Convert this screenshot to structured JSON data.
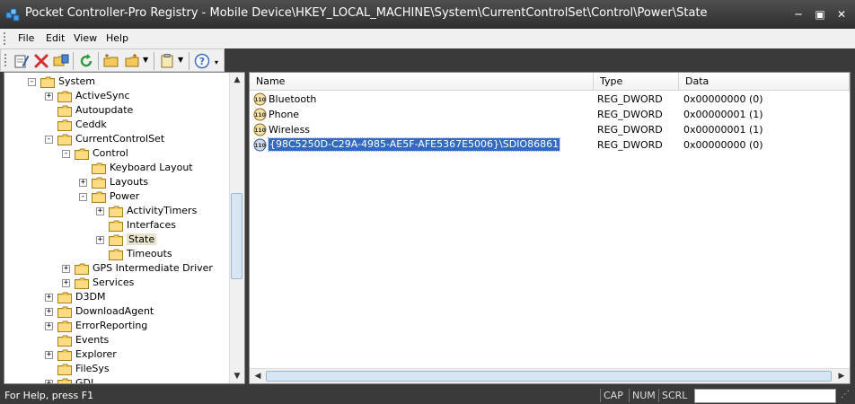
{
  "window": {
    "title": "Pocket Controller-Pro Registry - Mobile Device\\HKEY_LOCAL_MACHINE\\System\\CurrentControlSet\\Control\\Power\\State",
    "minimize_glyph": "─",
    "restore_glyph": "▣",
    "close_glyph": "✕"
  },
  "menu": {
    "items": [
      {
        "label": "File"
      },
      {
        "label": "Edit"
      },
      {
        "label": "View"
      },
      {
        "label": "Help"
      }
    ]
  },
  "toolbar": {
    "icons": [
      "edit-icon",
      "delete-icon",
      "open-folder-icon",
      "refresh-icon",
      "new-key-icon",
      "new-value-icon",
      "clipboard-icon",
      "help-icon"
    ]
  },
  "tree": {
    "nodes": [
      {
        "label": "System",
        "depth": 0,
        "expander": "-"
      },
      {
        "label": "ActiveSync",
        "depth": 1,
        "expander": "+"
      },
      {
        "label": "Autoupdate",
        "depth": 1,
        "expander": ""
      },
      {
        "label": "Ceddk",
        "depth": 1,
        "expander": ""
      },
      {
        "label": "CurrentControlSet",
        "depth": 1,
        "expander": "-"
      },
      {
        "label": "Control",
        "depth": 2,
        "expander": "-"
      },
      {
        "label": "Keyboard Layout",
        "depth": 3,
        "expander": ""
      },
      {
        "label": "Layouts",
        "depth": 3,
        "expander": "+"
      },
      {
        "label": "Power",
        "depth": 3,
        "expander": "-"
      },
      {
        "label": "ActivityTimers",
        "depth": 4,
        "expander": "+"
      },
      {
        "label": "Interfaces",
        "depth": 4,
        "expander": ""
      },
      {
        "label": "State",
        "depth": 4,
        "expander": "+",
        "selected": true
      },
      {
        "label": "Timeouts",
        "depth": 4,
        "expander": ""
      },
      {
        "label": "GPS Intermediate Driver",
        "depth": 2,
        "expander": "+"
      },
      {
        "label": "Services",
        "depth": 2,
        "expander": "+"
      },
      {
        "label": "D3DM",
        "depth": 1,
        "expander": "+"
      },
      {
        "label": "DownloadAgent",
        "depth": 1,
        "expander": "+"
      },
      {
        "label": "ErrorReporting",
        "depth": 1,
        "expander": "+"
      },
      {
        "label": "Events",
        "depth": 1,
        "expander": ""
      },
      {
        "label": "Explorer",
        "depth": 1,
        "expander": "+"
      },
      {
        "label": "FileSys",
        "depth": 1,
        "expander": ""
      },
      {
        "label": "GDI",
        "depth": 1,
        "expander": "+"
      }
    ]
  },
  "values_list": {
    "columns": {
      "name": "Name",
      "type": "Type",
      "data": "Data"
    },
    "rows": [
      {
        "icon": "dword-value-icon",
        "name": "Bluetooth",
        "type": "REG_DWORD",
        "data": "0x00000000 (0)"
      },
      {
        "icon": "dword-value-icon",
        "name": "Phone",
        "type": "REG_DWORD",
        "data": "0x00000001 (1)"
      },
      {
        "icon": "dword-value-icon",
        "name": "Wireless",
        "type": "REG_DWORD",
        "data": "0x00000001 (1)"
      },
      {
        "icon": "dword-value-icon",
        "name": "{98C5250D-C29A-4985-AE5F-AFE5367E5006}\\SDIO86861",
        "type": "REG_DWORD",
        "data": "0x00000000 (0)",
        "selected": true
      }
    ]
  },
  "statusbar": {
    "help_text": "For Help, press F1",
    "cap": "CAP",
    "num": "NUM",
    "scrl": "SCRL"
  },
  "colors": {
    "selection": "#3369c3",
    "folder": "#f3c95b",
    "titlebar": "#3a3a3a"
  }
}
